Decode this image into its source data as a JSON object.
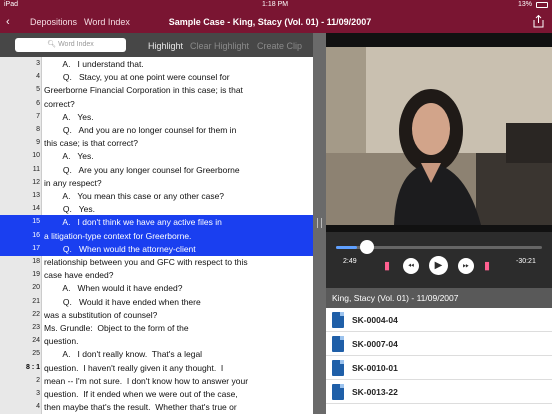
{
  "status": {
    "carrier": "iPad",
    "time": "1:18 PM",
    "battery": "13%"
  },
  "nav": {
    "back": "‹",
    "depositions": "Depositions",
    "word_index": "Word Index",
    "title": "Sample Case - King, Stacy (Vol. 01) - 11/09/2007"
  },
  "toolbar": {
    "search_placeholder": "Word Index",
    "highlight": "Highlight",
    "clear_highlight": "Clear Highlight",
    "create_clip": "Create Clip"
  },
  "transcript": [
    {
      "ln": "3",
      "text": "        A.   I understand that.",
      "hl": false
    },
    {
      "ln": "4",
      "text": "        Q.   Stacy, you at one point were counsel for",
      "hl": false
    },
    {
      "ln": "5",
      "text": "Greerborne Financial Corporation in this case; is that",
      "hl": false
    },
    {
      "ln": "6",
      "text": "correct?",
      "hl": false
    },
    {
      "ln": "7",
      "text": "        A.   Yes.",
      "hl": false
    },
    {
      "ln": "8",
      "text": "        Q.   And you are no longer counsel for them in",
      "hl": false
    },
    {
      "ln": "9",
      "text": "this case; is that correct?",
      "hl": false
    },
    {
      "ln": "10",
      "text": "        A.   Yes.",
      "hl": false
    },
    {
      "ln": "11",
      "text": "        Q.   Are you any longer counsel for Greerborne",
      "hl": false
    },
    {
      "ln": "12",
      "text": "in any respect?",
      "hl": false
    },
    {
      "ln": "13",
      "text": "        A.   You mean this case or any other case?",
      "hl": false
    },
    {
      "ln": "14",
      "text": "        Q.   Yes.",
      "hl": false
    },
    {
      "ln": "15",
      "text": "        A.   I don't think we have any active files in",
      "hl": true
    },
    {
      "ln": "16",
      "text": "a litigation-type context for Greerborne.",
      "hl": true
    },
    {
      "ln": "17",
      "text": "        Q.   When would the attorney-client",
      "hl": true
    },
    {
      "ln": "18",
      "text": "relationship between you and GFC with respect to this",
      "hl": false
    },
    {
      "ln": "19",
      "text": "case have ended?",
      "hl": false
    },
    {
      "ln": "20",
      "text": "        A.   When would it have ended?",
      "hl": false
    },
    {
      "ln": "21",
      "text": "        Q.   Would it have ended when there",
      "hl": false
    },
    {
      "ln": "22",
      "text": "was a substitution of counsel?",
      "hl": false
    },
    {
      "ln": "23",
      "text": "Ms. Grundle:  Object to the form of the",
      "hl": false
    },
    {
      "ln": "24",
      "text": "question.",
      "hl": false
    },
    {
      "ln": "25",
      "text": "        A.   I don't really know.  That's a legal",
      "hl": false
    },
    {
      "ln": "8 :  1",
      "text": "question.  I haven't really given it any thought.  I",
      "hl": false
    },
    {
      "ln": "2",
      "text": "mean -- I'm not sure.  I don't know how to answer your",
      "hl": false
    },
    {
      "ln": "3",
      "text": "question.  If it ended when we were out of the case,",
      "hl": false
    },
    {
      "ln": "4",
      "text": "then maybe that's the result.  Whether that's true or",
      "hl": false
    }
  ],
  "player": {
    "elapsed": "2:49",
    "remaining": "-30:21",
    "progress": 0.1
  },
  "deposition_label": "King, Stacy (Vol. 01) - 11/09/2007",
  "exhibits": [
    "SK-0004-04",
    "SK-0007-04",
    "SK-0010-01",
    "SK-0013-22"
  ],
  "colors": {
    "nav": "#7a1532",
    "highlight": "#1a3ff0",
    "exhibit_icon": "#1f5fa8"
  }
}
